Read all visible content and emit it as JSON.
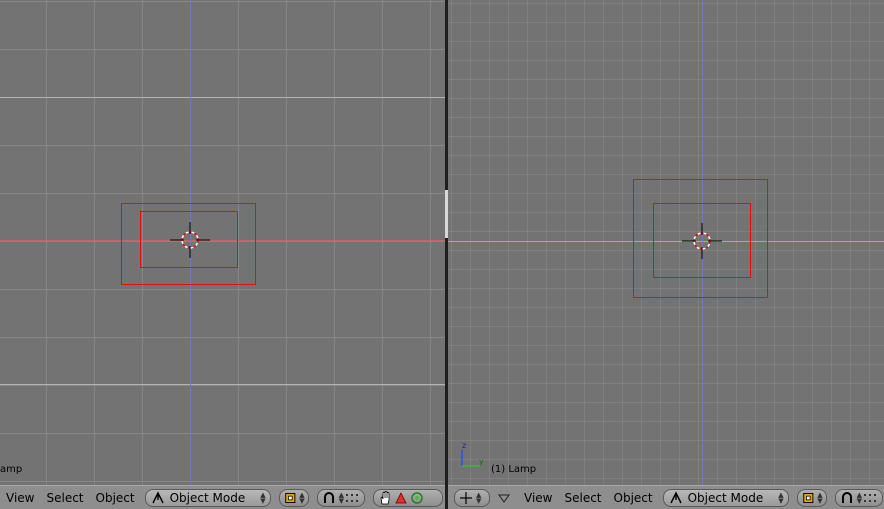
{
  "left_view": {
    "label": "amp",
    "axis_color_horizontal": "#c86464",
    "axis_color_vertical": "#7878b4",
    "lamp_color": "#e01010"
  },
  "right_view": {
    "label": "(1) Lamp",
    "axis_color_horizontal": "#78c878",
    "axis_color_vertical": "#7878b4",
    "lamp_color": "#e01010",
    "gizmo": {
      "z_label": "z",
      "y_label": "y"
    }
  },
  "left_header": {
    "menus": [
      "View",
      "Select",
      "Object"
    ],
    "mode": "Object Mode",
    "icons": [
      "pivot-icon",
      "snap-icon",
      "grid-icon",
      "hand-icon",
      "triangle-icon",
      "circle-icon"
    ]
  },
  "right_header": {
    "menus": [
      "View",
      "Select",
      "Object"
    ],
    "mode": "Object Mode",
    "icons": [
      "view-cross-icon",
      "dropdown-triangle-icon",
      "pivot-icon",
      "snap-icon"
    ]
  }
}
